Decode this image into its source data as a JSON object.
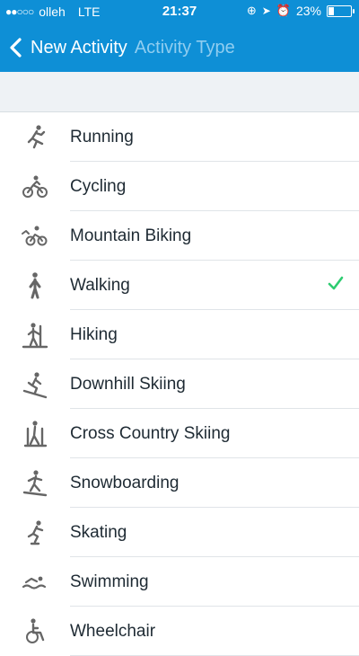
{
  "status_bar": {
    "carrier": "olleh",
    "network": "LTE",
    "time": "21:37",
    "battery": "23%",
    "battery_level": 0.23,
    "signal_filled": 2,
    "signal_total": 5
  },
  "nav": {
    "back_label": "New Activity",
    "title": "Activity Type"
  },
  "colors": {
    "accent": "#0e8fd6",
    "check": "#2ecc71"
  },
  "activities": [
    {
      "label": "Running",
      "icon": "running-icon",
      "selected": false
    },
    {
      "label": "Cycling",
      "icon": "cycling-icon",
      "selected": false
    },
    {
      "label": "Mountain Biking",
      "icon": "mountain-biking-icon",
      "selected": false
    },
    {
      "label": "Walking",
      "icon": "walking-icon",
      "selected": true
    },
    {
      "label": "Hiking",
      "icon": "hiking-icon",
      "selected": false
    },
    {
      "label": "Downhill Skiing",
      "icon": "downhill-skiing-icon",
      "selected": false
    },
    {
      "label": "Cross Country Skiing",
      "icon": "cross-country-skiing-icon",
      "selected": false
    },
    {
      "label": "Snowboarding",
      "icon": "snowboarding-icon",
      "selected": false
    },
    {
      "label": "Skating",
      "icon": "skating-icon",
      "selected": false
    },
    {
      "label": "Swimming",
      "icon": "swimming-icon",
      "selected": false
    },
    {
      "label": "Wheelchair",
      "icon": "wheelchair-icon",
      "selected": false
    }
  ]
}
